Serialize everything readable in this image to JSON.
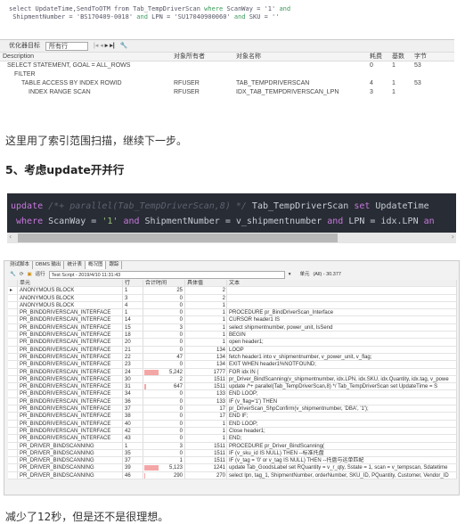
{
  "sql_top": {
    "line1": [
      "select UpdateTime,SendToOTM from Tab_TempDriverScan ",
      "where",
      " ScanWay = '1' ",
      "and"
    ],
    "line2": [
      " ShipmentNumber = 'BS170409-0018' ",
      "and",
      " LPN = 'SU17040900060' ",
      "and",
      " SKU = ''"
    ]
  },
  "plan": {
    "toolbar_label": "优化器目标",
    "toolbar_select": "所有行",
    "headers": [
      "Description",
      "对象所有者",
      "对象名称",
      "耗费",
      "基数",
      "字节"
    ],
    "rows": [
      [
        "SELECT STATEMENT, GOAL = ALL_ROWS",
        "",
        "",
        "0",
        "1",
        "53"
      ],
      [
        "FILTER",
        "",
        "",
        "",
        "",
        ""
      ],
      [
        "TABLE ACCESS BY INDEX ROWID",
        "RFUSER",
        "TAB_TEMPDRIVERSCAN",
        "4",
        "1",
        "53"
      ],
      [
        "INDEX RANGE SCAN",
        "RFUSER",
        "IDX_TAB_TEMPDRIVERSCAN_LPN",
        "3",
        "1",
        ""
      ]
    ]
  },
  "para1": "这里用了索引范围扫描，继续下一步。",
  "heading": "5、考虑update开并行",
  "code": {
    "l1": [
      "update",
      " /*+ parallel(Tab_TempDriverScan,8) */",
      " Tab_TempDriverScan ",
      "set",
      " UpdateTime "
    ],
    "l2": [
      " where",
      " ScanWay = ",
      "'1'",
      " ",
      "and",
      " ShipmentNumber = v_shipmentnumber ",
      "and",
      " LPN = idx.LPN ",
      "an"
    ]
  },
  "profiler": {
    "tabs": [
      "测试脚本",
      "DBMS 输出",
      "统计表",
      "概况图",
      "跟踪"
    ],
    "active_tab": 3,
    "run_label": "运行",
    "run_select": "Test Script - 2019/4/10 11:31:43",
    "unit_label": "单元",
    "unit_value": "(All) - 30.377",
    "headers": [
      "单元",
      "行",
      "合计时间",
      "具体值",
      "文本"
    ],
    "max_time": 5242,
    "rows": [
      [
        "ANONYMOUS BLOCK",
        "1",
        "25",
        "2",
        ""
      ],
      [
        "ANONYMOUS BLOCK",
        "3",
        "0",
        "2",
        ""
      ],
      [
        "ANONYMOUS BLOCK",
        "4",
        "0",
        "1",
        ""
      ],
      [
        "PR_BINDDRIVERSCAN_INTERFACE",
        "1",
        "0",
        "1",
        "PROCEDURE pr_BindDriverScan_Interface"
      ],
      [
        "PR_BINDDRIVERSCAN_INTERFACE",
        "14",
        "0",
        "1",
        "CURSOR header1 IS"
      ],
      [
        "PR_BINDDRIVERSCAN_INTERFACE",
        "15",
        "3",
        "1",
        "select shipmentnumber, power_unit, IsSend"
      ],
      [
        "PR_BINDDRIVERSCAN_INTERFACE",
        "18",
        "0",
        "1",
        "BEGIN"
      ],
      [
        "PR_BINDDRIVERSCAN_INTERFACE",
        "20",
        "0",
        "1",
        "open header1;"
      ],
      [
        "PR_BINDDRIVERSCAN_INTERFACE",
        "21",
        "0",
        "134",
        "LOOP"
      ],
      [
        "PR_BINDDRIVERSCAN_INTERFACE",
        "22",
        "47",
        "134",
        "fetch header1 into v_shipmentnumber, v_power_unit, v_flag;"
      ],
      [
        "PR_BINDDRIVERSCAN_INTERFACE",
        "23",
        "0",
        "134",
        "EXIT WHEN header1%NOTFOUND;"
      ],
      [
        "PR_BINDDRIVERSCAN_INTERFACE",
        "24",
        "5,242",
        "1777",
        "FOR idx IN ("
      ],
      [
        "PR_BINDDRIVERSCAN_INTERFACE",
        "30",
        "2",
        "1511",
        "pr_Driver_BindScanning(v_shipmentnumber, idx.LPN, idx.SKU, idx.Quantity, idx.tag, v_powe"
      ],
      [
        "PR_BINDDRIVERSCAN_INTERFACE",
        "31",
        "647",
        "1511",
        "update /*+ parallel(Tab_TempDriverScan,8) */ Tab_TempDriverScan set UpdateTime = S"
      ],
      [
        "PR_BINDDRIVERSCAN_INTERFACE",
        "34",
        "0",
        "133",
        "END LOOP;"
      ],
      [
        "PR_BINDDRIVERSCAN_INTERFACE",
        "36",
        "0",
        "133",
        "IF (v_flag='1') THEN"
      ],
      [
        "PR_BINDDRIVERSCAN_INTERFACE",
        "37",
        "0",
        "17",
        "pr_DriverScan_ShpConfirm(v_shipmentnumber, 'DBA', '1');"
      ],
      [
        "PR_BINDDRIVERSCAN_INTERFACE",
        "38",
        "0",
        "17",
        "END IF;"
      ],
      [
        "PR_BINDDRIVERSCAN_INTERFACE",
        "40",
        "0",
        "1",
        "END LOOP;"
      ],
      [
        "PR_BINDDRIVERSCAN_INTERFACE",
        "42",
        "0",
        "1",
        "Close header1;"
      ],
      [
        "PR_BINDDRIVERSCAN_INTERFACE",
        "43",
        "0",
        "1",
        "END;"
      ],
      [
        "PR_DRIVER_BINDSCANNING",
        "1",
        "3",
        "1511",
        "PROCEDURE pr_Driver_BindScanning("
      ],
      [
        "PR_DRIVER_BINDSCANNING",
        "35",
        "0",
        "1511",
        "IF (v_sku_id IS NULL) THEN  --标准托盘"
      ],
      [
        "PR_DRIVER_BINDSCANNING",
        "37",
        "1",
        "1511",
        "IF (v_tag = '0' or v_tag IS NULL) THEN  --托盘与运单匹配"
      ],
      [
        "PR_DRIVER_BINDSCANNING",
        "39",
        "5,123",
        "1241",
        "update Tab_GoodsLabel set RQuantity = v_r_qty, Sstate = 1, scan = v_tempscan, Sdatetime"
      ],
      [
        "PR_DRIVER_BINDSCANNING",
        "46",
        "290",
        "270",
        "select lpn, tag_1, ShipmentNumber, orderNumber, SKU_ID, PQuantity, Customer, Vendor_ID"
      ]
    ]
  },
  "para2": "减少了12秒，但是还不是很理想。",
  "colors": {
    "code_bg": "#282c34",
    "keyword": "#c678dd",
    "string": "#98c379",
    "time_bar": "#f4a6a6"
  }
}
